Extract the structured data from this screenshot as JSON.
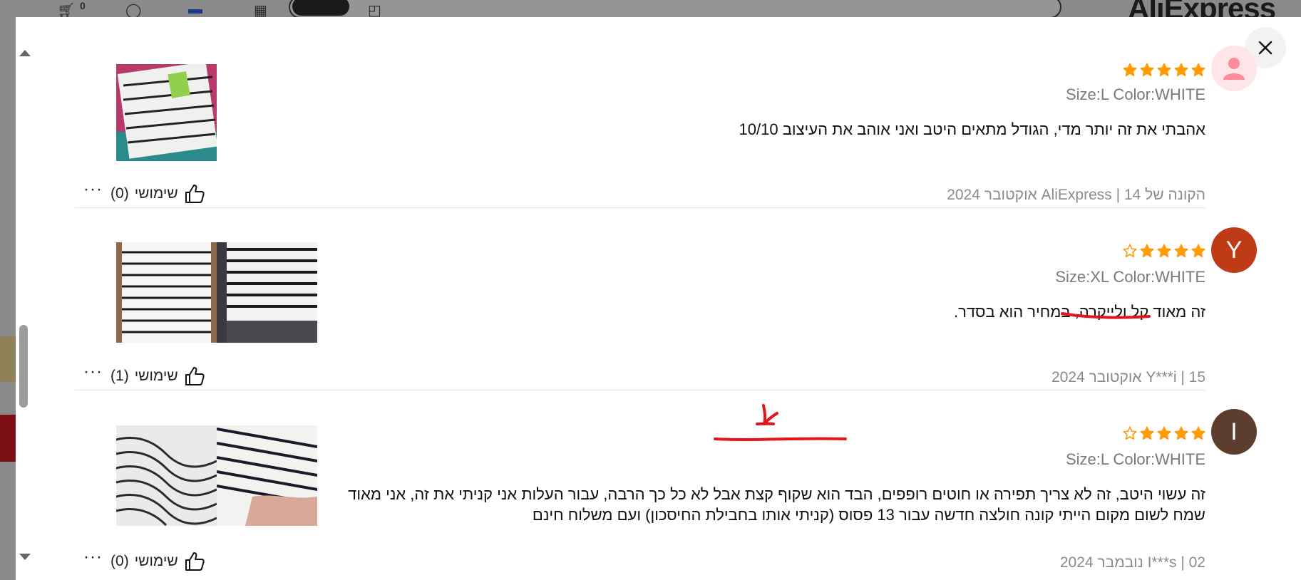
{
  "header": {
    "logo": "AliExpress",
    "cart_count": "0"
  },
  "modal": {
    "close_label": "×"
  },
  "reviews": [
    {
      "avatar_letter": "",
      "avatar_color": "#ffe4e8",
      "rating": 5,
      "variant": "Size:L Color:WHITE",
      "text": "אהבתי את זה יותר מדי, הגודל מתאים היטב ואני אוהב את העיצוב 10/10",
      "meta": "הקונה של AliExpress | 14 אוקטובר 2024",
      "helpful_label": "שימושי",
      "helpful_count": "(0)",
      "photos": 1
    },
    {
      "avatar_letter": "Y",
      "avatar_color": "#bf3b15",
      "rating": 4,
      "variant": "Size:XL Color:WHITE",
      "text": "זה מאוד קל ולייקרה, במחיר הוא בסדר.",
      "meta": "Y***i | 15 אוקטובר 2024",
      "helpful_label": "שימושי",
      "helpful_count": "(1)",
      "photos": 2
    },
    {
      "avatar_letter": "I",
      "avatar_color": "#5c3d2e",
      "rating": 4,
      "variant": "Size:L Color:WHITE",
      "text": "זה עשוי היטב, זה לא צריך תפירה או חוטים רופפים, הבד הוא שקוף קצת אבל לא כל כך הרבה, עבור העלות אני קניתי את זה, אני מאוד שמח לשום מקום הייתי קונה חולצה חדשה עבור 13 פסוס (קניתי אותו בחבילת החיסכון) ועם משלוח חינם",
      "meta": "I***s | 02 נובמבר 2024",
      "helpful_label": "שימושי",
      "helpful_count": "(0)",
      "photos": 2
    }
  ],
  "colors": {
    "star": "#ff9a00",
    "annotation": "#e0161b"
  }
}
